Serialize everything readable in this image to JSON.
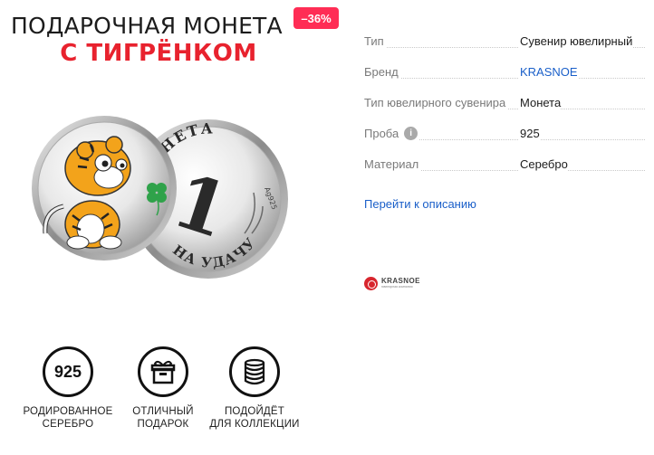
{
  "product": {
    "title_line1": "ПОДАРОЧНАЯ МОНЕТА",
    "title_line2": "С ТИГРЁНКОМ",
    "discount": "–36%",
    "coin_back": {
      "top_text": "МОНЕТА",
      "denomination": "1",
      "bottom_text": "НА УДАЧУ",
      "hallmark": "Ag925"
    }
  },
  "features": [
    {
      "icon": "925-hallmark-icon",
      "icon_text": "925",
      "caption_line1": "РОДИРОВАННОЕ",
      "caption_line2": "СЕРЕБРО"
    },
    {
      "icon": "gift-box-icon",
      "caption_line1": "ОТЛИЧНЫЙ",
      "caption_line2": "ПОДАРОК"
    },
    {
      "icon": "coin-stack-icon",
      "caption_line1": "ПОДОЙДЁТ",
      "caption_line2": "ДЛЯ КОЛЛЕКЦИИ"
    }
  ],
  "specs": [
    {
      "label": "Тип",
      "value": "Сувенир ювелирный"
    },
    {
      "label": "Бренд",
      "value": "KRASNOE"
    },
    {
      "label": "Тип ювелирного сувенира",
      "value": "Монета"
    },
    {
      "label": "Проба",
      "value": "925"
    },
    {
      "label": "Материал",
      "value": "Серебро"
    }
  ],
  "description_link": "Перейти к описанию",
  "brand_logo": {
    "name": "KRASNOE",
    "tagline": "ювелирная компания"
  },
  "colors": {
    "accent_red": "#e8222e",
    "badge_pink": "#ff2d55",
    "link_blue": "#1a5fc9"
  }
}
